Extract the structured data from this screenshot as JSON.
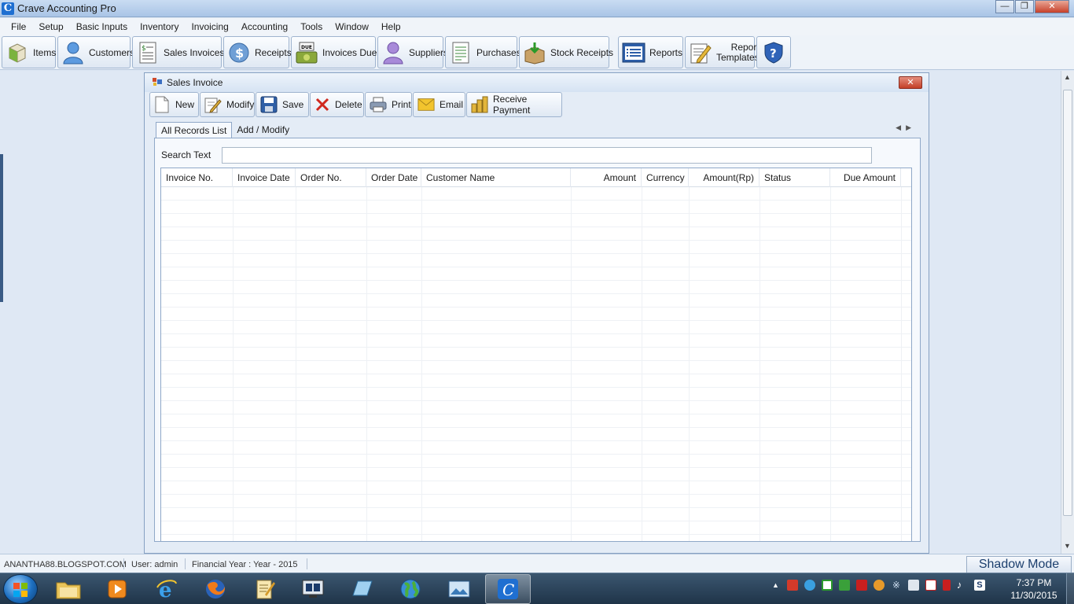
{
  "window": {
    "title": "Crave Accounting Pro"
  },
  "menu": [
    "File",
    "Setup",
    "Basic Inputs",
    "Inventory",
    "Invoicing",
    "Accounting",
    "Tools",
    "Window",
    "Help"
  ],
  "toolbar": {
    "items": "Items",
    "customers": "Customers",
    "sales_invoices": "Sales Invoices",
    "receipts": "Receipts",
    "invoices_due": "Invoices Due",
    "invoices_due_badge": "DUE",
    "suppliers": "Suppliers",
    "purchases": "Purchases",
    "stock_receipts": "Stock Receipts",
    "reports": "Reports",
    "report_templates_line1": "Report",
    "report_templates_line2": "Templates"
  },
  "child_window": {
    "title": "Sales Invoice",
    "buttons": {
      "new": "New",
      "modify": "Modify",
      "save": "Save",
      "delete": "Delete",
      "print": "Print",
      "email": "Email",
      "receive_payment": "Receive Payment"
    },
    "tabs": {
      "all_records": "All Records List",
      "add_modify": "Add / Modify",
      "active": "All Records List"
    },
    "search": {
      "label": "Search Text",
      "value": ""
    },
    "grid": {
      "columns": [
        "Invoice No.",
        "Invoice Date",
        "Order No.",
        "Order Date",
        "Customer Name",
        "Amount",
        "Currency",
        "Amount(Rp)",
        "Status",
        "Due Amount"
      ],
      "rows": []
    }
  },
  "statusbar": {
    "site": "ANANTHA88.BLOGSPOT.COM",
    "user": "User: admin",
    "financial_year": "Financial Year : Year - 2015",
    "shadow_mode": "Shadow Mode"
  },
  "taskbar": {
    "time": "7:37 PM",
    "date": "11/30/2015"
  }
}
